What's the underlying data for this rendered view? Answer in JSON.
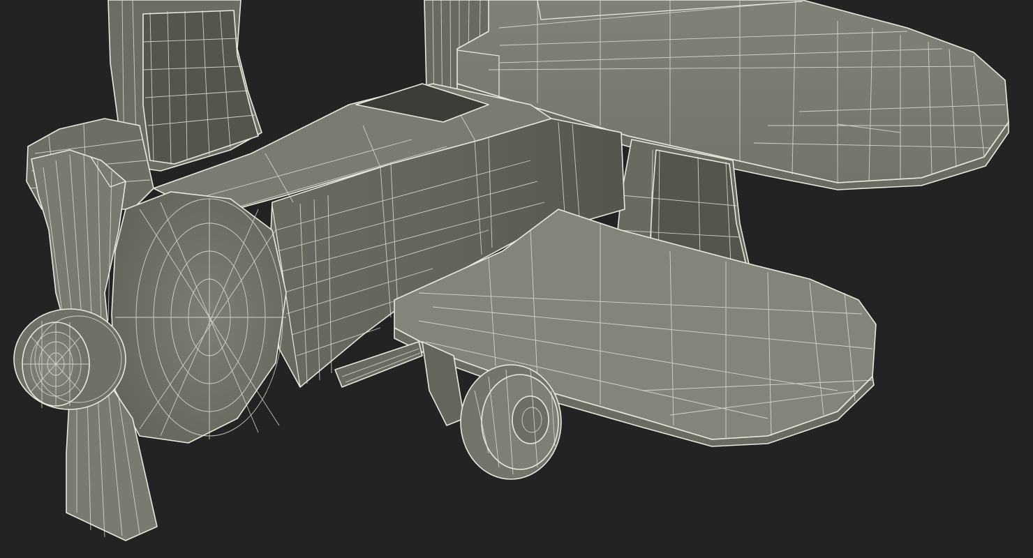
{
  "scene": {
    "subject": "toy-biplane-wireframe",
    "colors": {
      "background": "#232323",
      "surface": "#7b7b70",
      "surface_light": "#88887d",
      "surface_dark": "#5f5f56",
      "shadow": "#4a4a43",
      "wire": "#e6e5da"
    }
  }
}
